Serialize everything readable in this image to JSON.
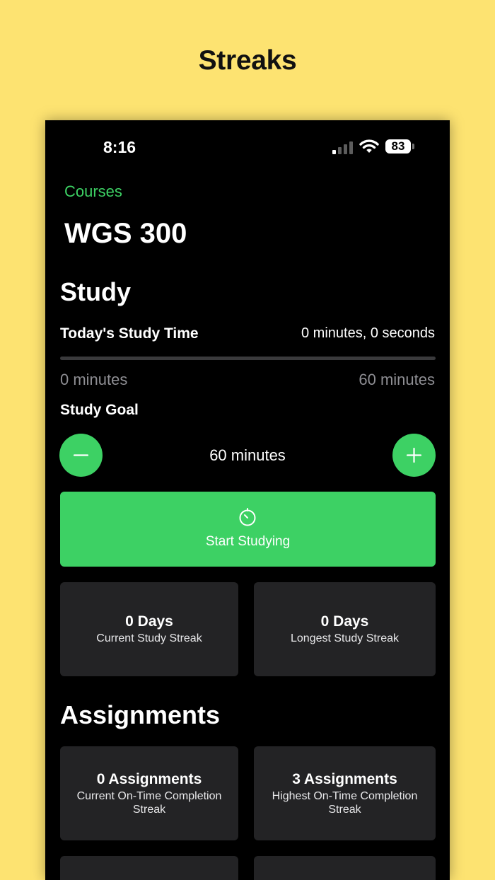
{
  "promo": {
    "title": "Streaks"
  },
  "status_bar": {
    "time": "8:16",
    "battery": "83"
  },
  "nav": {
    "back_label": "Courses"
  },
  "course": {
    "title": "WGS 300"
  },
  "study": {
    "section_title": "Study",
    "time_label": "Today's Study Time",
    "time_value": "0 minutes, 0 seconds",
    "progress_fraction": 0,
    "range_min": "0 minutes",
    "range_max": "60 minutes",
    "goal_label": "Study Goal",
    "goal_value": "60 minutes",
    "start_label": "Start Studying",
    "streaks": [
      {
        "value": "0 Days",
        "label": "Current Study Streak"
      },
      {
        "value": "0 Days",
        "label": "Longest Study Streak"
      }
    ]
  },
  "assignments": {
    "section_title": "Assignments",
    "streaks": [
      {
        "value": "0 Assignments",
        "label": "Current On-Time Completion Streak"
      },
      {
        "value": "3 Assignments",
        "label": "Highest On-Time Completion Streak"
      }
    ]
  },
  "colors": {
    "accent": "#3DD164",
    "background": "#FDE371",
    "card": "#232325"
  },
  "icons": {
    "minus": "minus-icon",
    "plus": "plus-icon",
    "timer": "timer-icon",
    "wifi": "wifi-icon",
    "signal": "signal-icon",
    "battery": "battery-icon"
  }
}
